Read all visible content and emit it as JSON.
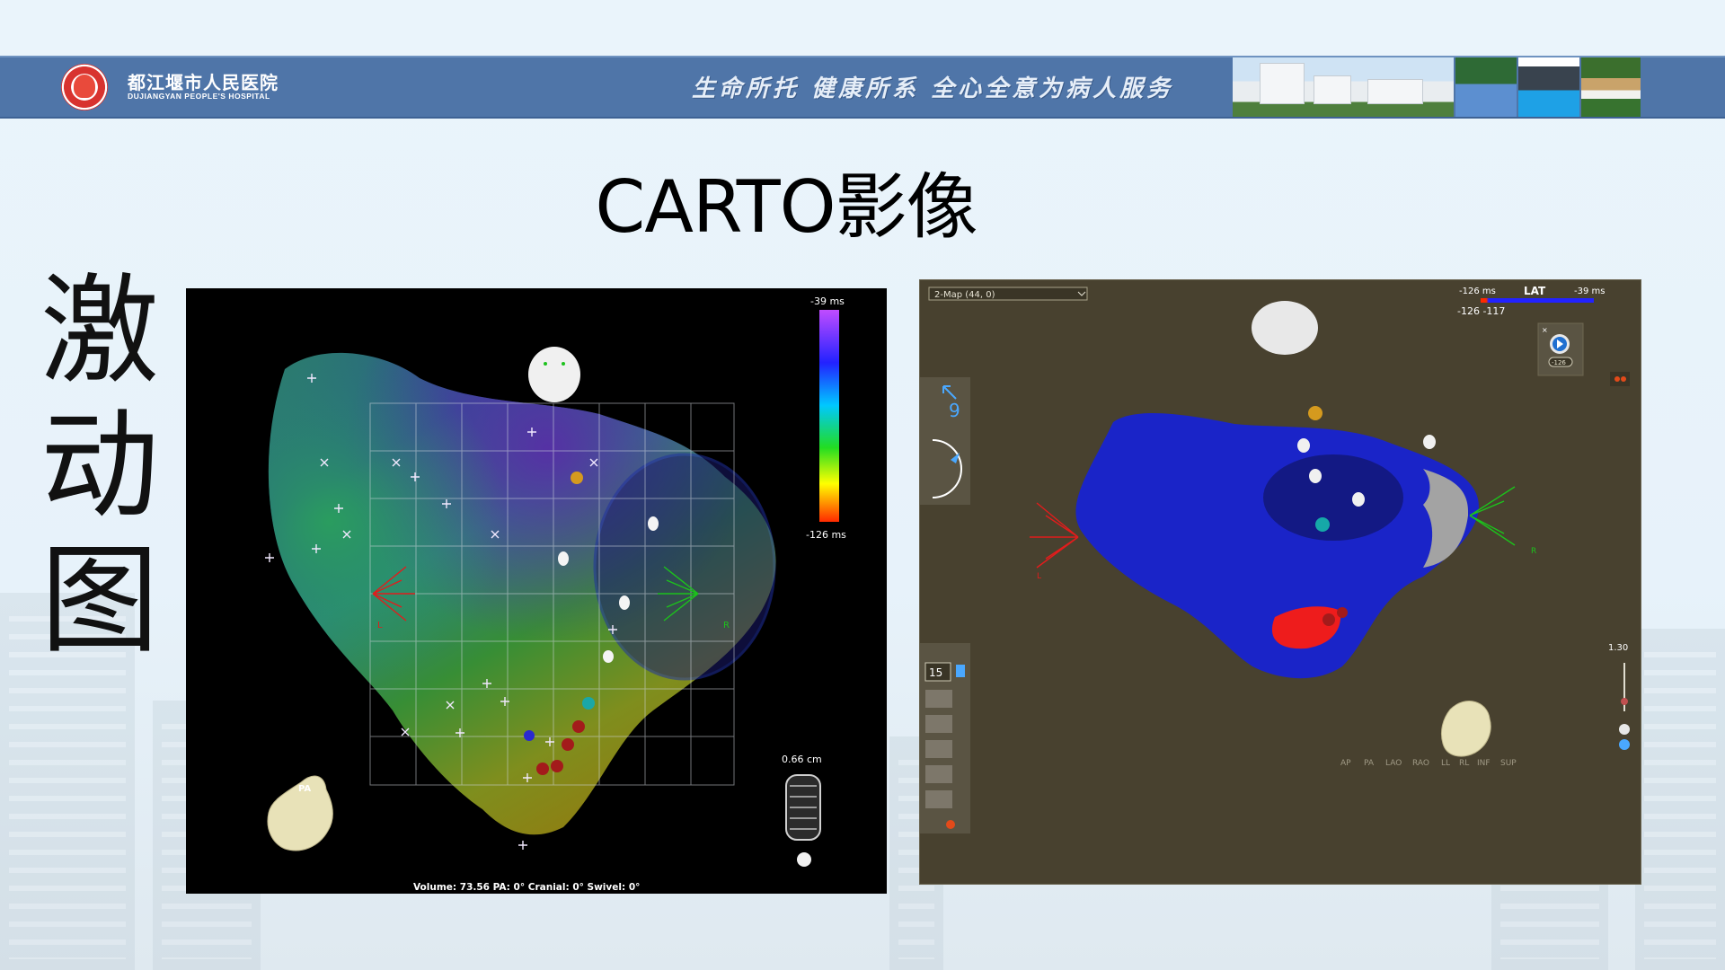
{
  "header": {
    "hospital_cn": "都江堰市人民医院",
    "hospital_en": "DUJIANGYAN PEOPLE'S HOSPITAL",
    "slogan": "生命所托 健康所系 全心全意为病人服务"
  },
  "slide": {
    "title": "CARTO影像",
    "side_label": [
      "激",
      "动",
      "图"
    ]
  },
  "left_map": {
    "scale_top": "-39 ms",
    "scale_bottom": "-126 ms",
    "orientation_label": "PA",
    "distance": "0.66 cm",
    "left_marker": "L",
    "right_marker": "R",
    "status_line": "Volume: 73.56    PA: 0°    Cranial: 0°    Swivel: 0°"
  },
  "right_map": {
    "map_select": "2-Map (44, 0)",
    "lat_label": "LAT",
    "lat_min": "-126 ms",
    "lat_max": "-39 ms",
    "window_values": "-126  -117",
    "play_value": "-126",
    "speed_value": "9",
    "tool_number": "15",
    "zoom_value": "1.30",
    "left_marker": "L",
    "right_marker": "R",
    "views": [
      "AP",
      "PA",
      "LAO",
      "RAO",
      "LL",
      "RL",
      "INF",
      "SUP"
    ]
  }
}
